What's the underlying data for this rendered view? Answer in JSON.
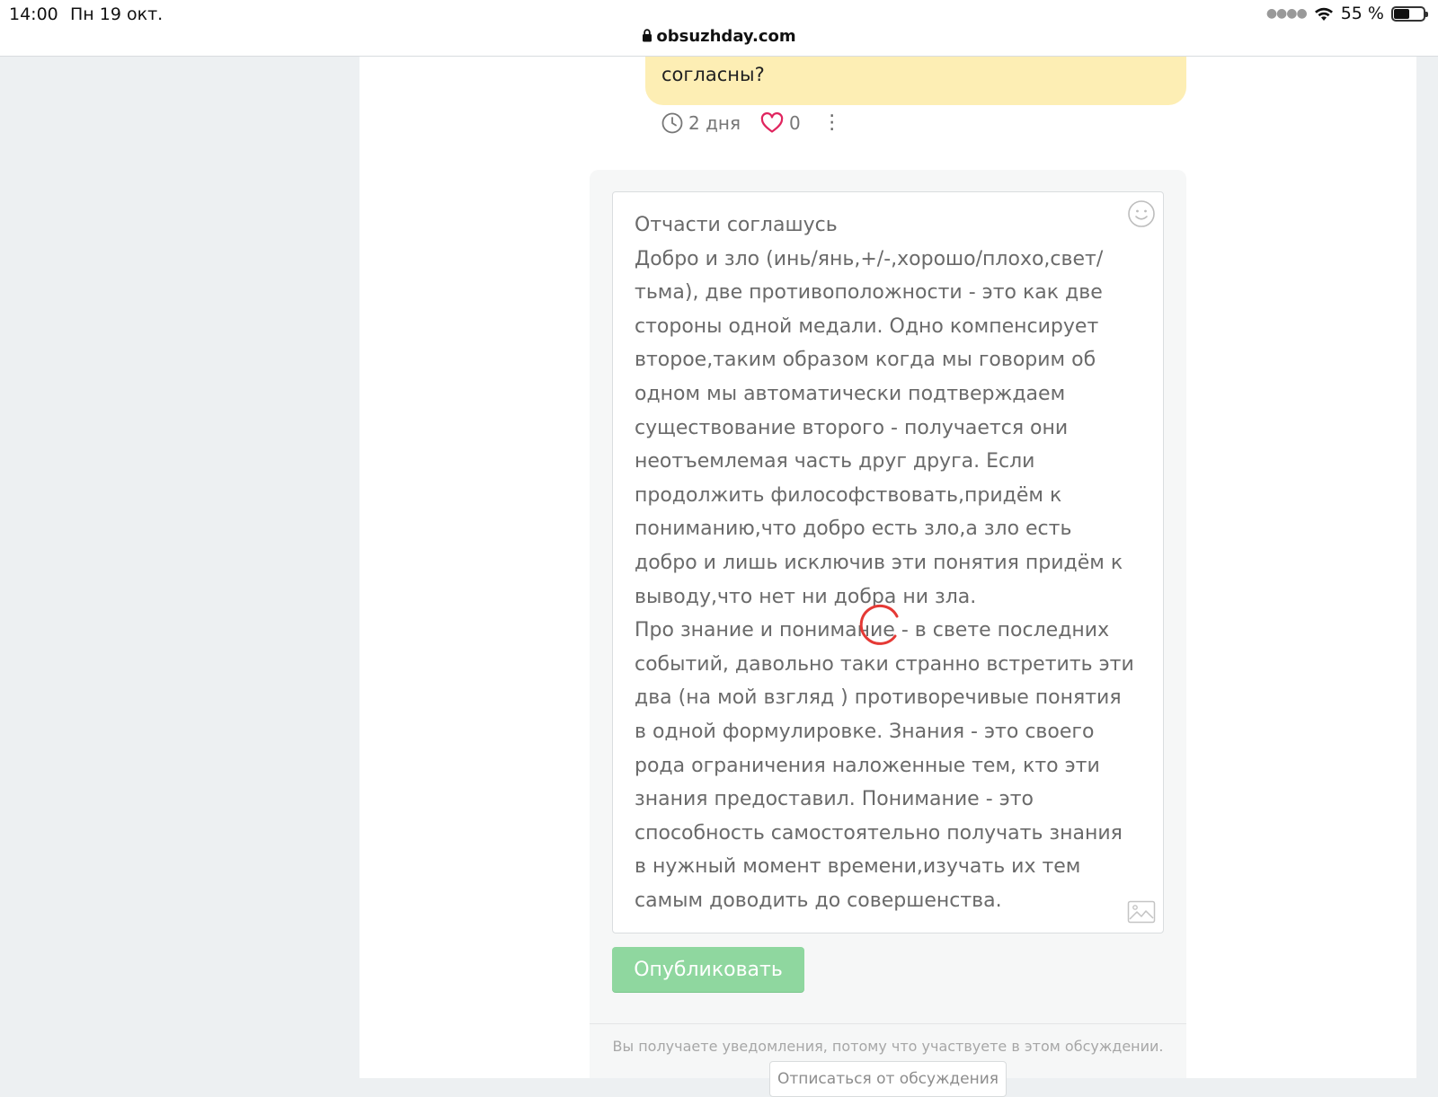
{
  "status_bar": {
    "time": "14:00",
    "date": "Пн 19 окт.",
    "battery_percent": "55 %",
    "battery_level": 0.55,
    "url": "obsuzhday.com"
  },
  "previous_message": {
    "text": "согласны?",
    "background_color": "#fdeeb4",
    "age": "2 дня",
    "likes": "0"
  },
  "composer": {
    "text": "Отчасти соглашусь\nДобро и зло (инь/янь,+/-,хорошо/плохо,свет/тьма), две противоположности - это как две стороны одной медали. Одно компенсирует второе,таким образом когда мы говорим об одном мы автоматически подтверждаем существование второго - получается они неотъемлемая часть друг друга. Если продолжить философствовать,придём к пониманию,что добро есть зло,а зло есть добро и лишь исключив эти понятия придём к выводу,что нет ни добра ни зла.\nПро знание и понимание - в свете последних событий, давольно таки странно встретить эти два (на мой взгляд ) противоречивые понятия в одной формулировке. Знания - это своего рода ограничения наложенные тем, кто эти знания предоставил. Понимание - это способность самостоятельно получать знания в нужный момент времени,изучать их тем самым доводить до совершенства.",
    "publish_label": "Опубликовать",
    "publish_color": "#8fd79f",
    "emoji_icon": "smiley-icon",
    "image_icon": "image-icon"
  },
  "footer": {
    "notice": "Вы получаете уведомления, потому что участвуете в этом обсуждении.",
    "unsubscribe_label": "Отписаться от обсуждения"
  },
  "accent_colors": {
    "like_heart": "#e0245e",
    "spinner": "#e53935"
  }
}
